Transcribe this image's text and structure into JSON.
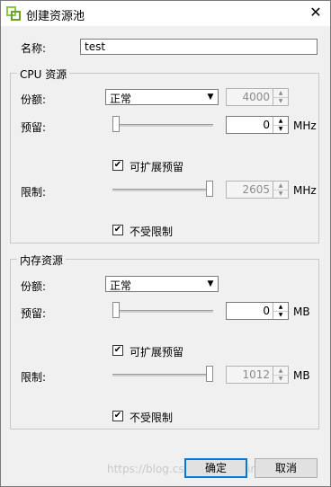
{
  "window": {
    "title": "创建资源池",
    "close_glyph": "✕"
  },
  "name_field": {
    "label": "名称:",
    "value": "test"
  },
  "cpu": {
    "group_title": "CPU 资源",
    "shares": {
      "label": "份额:",
      "value": "正常",
      "spin_value": "4000"
    },
    "reservation": {
      "label": "预留:",
      "value": "0",
      "unit": "MHz",
      "slider_fraction": 0.0
    },
    "expandable": {
      "label": "可扩展预留",
      "checked": true
    },
    "limit": {
      "label": "限制:",
      "value": "2605",
      "unit": "MHz",
      "slider_fraction": 1.0
    },
    "unlimited": {
      "label": "不受限制",
      "checked": true
    }
  },
  "memory": {
    "group_title": "内存资源",
    "shares": {
      "label": "份额:",
      "value": "正常"
    },
    "reservation": {
      "label": "预留:",
      "value": "0",
      "unit": "MB",
      "slider_fraction": 0.0
    },
    "expandable": {
      "label": "可扩展预留",
      "checked": true
    },
    "limit": {
      "label": "限制:",
      "value": "1012",
      "unit": "MB",
      "slider_fraction": 1.0
    },
    "unlimited": {
      "label": "不受限制",
      "checked": true
    }
  },
  "buttons": {
    "ok": "确定",
    "cancel": "取消"
  },
  "watermark": "https://blog.csdn.net/weixin_xiang",
  "colors": {
    "accent": "#0078d7",
    "icon": "#8dc63f"
  },
  "icons": {
    "app": "vmware-logo-icon",
    "check": "✔",
    "arrow_down": "▼",
    "arrow_up": "▲"
  }
}
